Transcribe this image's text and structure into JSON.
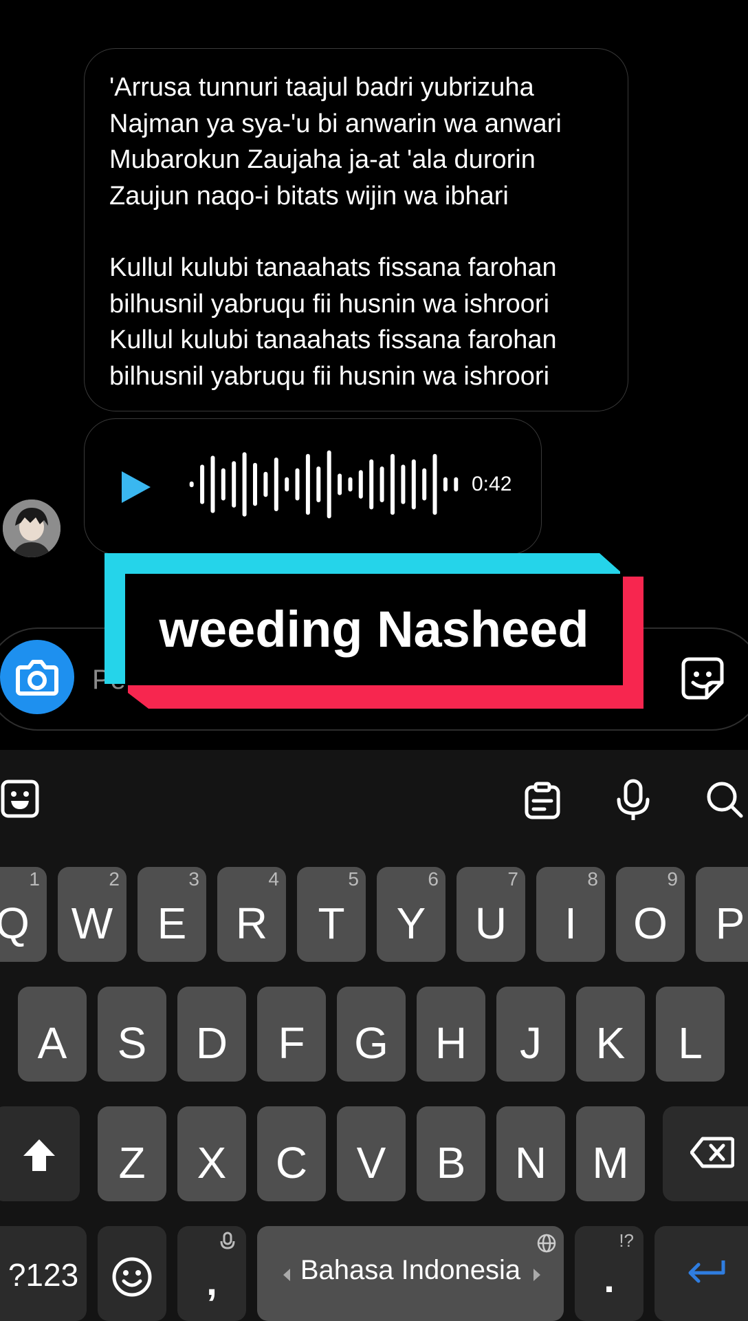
{
  "message": {
    "lyrics": [
      "'Arrusa tunnuri taajul badri yubrizuha",
      "Najman ya sya-'u bi anwarin wa anwari",
      "Mubarokun Zaujaha ja-at 'ala durorin",
      "Zaujun naqo-i bitats wijin wa ibhari",
      "",
      "Kullul kulubi tanaahats fissana farohan",
      "bilhusnil yabruqu fii husnin wa ishroori",
      "Kullul kulubi tanaahats fissana farohan",
      "bilhusnil yabruqu fii husnin wa ishroori"
    ]
  },
  "voice_note": {
    "duration": "0:42",
    "play_icon": "play-icon",
    "waveform_levels": [
      0.08,
      0.55,
      0.8,
      0.45,
      0.65,
      0.9,
      0.6,
      0.35,
      0.75,
      0.2,
      0.45,
      0.85,
      0.5,
      0.95,
      0.3,
      0.2,
      0.4,
      0.7,
      0.5,
      0.85,
      0.55,
      0.7,
      0.45,
      0.85,
      0.2,
      0.2
    ]
  },
  "composer": {
    "placeholder": "Pe",
    "camera_icon": "camera-icon",
    "sticker_icon": "sticker-icon"
  },
  "overlay": {
    "title": "weeding Nasheed"
  },
  "keyboard": {
    "toolbar_icons": [
      "emoji-icon",
      "clipboard-icon",
      "mic-icon",
      "search-icon"
    ],
    "row1": [
      {
        "letter": "Q",
        "num": "1"
      },
      {
        "letter": "W",
        "num": "2"
      },
      {
        "letter": "E",
        "num": "3"
      },
      {
        "letter": "R",
        "num": "4"
      },
      {
        "letter": "T",
        "num": "5"
      },
      {
        "letter": "Y",
        "num": "6"
      },
      {
        "letter": "U",
        "num": "7"
      },
      {
        "letter": "I",
        "num": "8"
      },
      {
        "letter": "O",
        "num": "9"
      },
      {
        "letter": "P",
        "num": ""
      }
    ],
    "row2": [
      "A",
      "S",
      "D",
      "F",
      "G",
      "H",
      "J",
      "K",
      "L"
    ],
    "row3": [
      "Z",
      "X",
      "C",
      "V",
      "B",
      "N",
      "M"
    ],
    "symbols_key": "?123",
    "comma_key": ",",
    "period_key": ".",
    "period_hint": "!?",
    "space_label": "Bahasa Indonesia",
    "accent_color": "#2f7de0"
  }
}
